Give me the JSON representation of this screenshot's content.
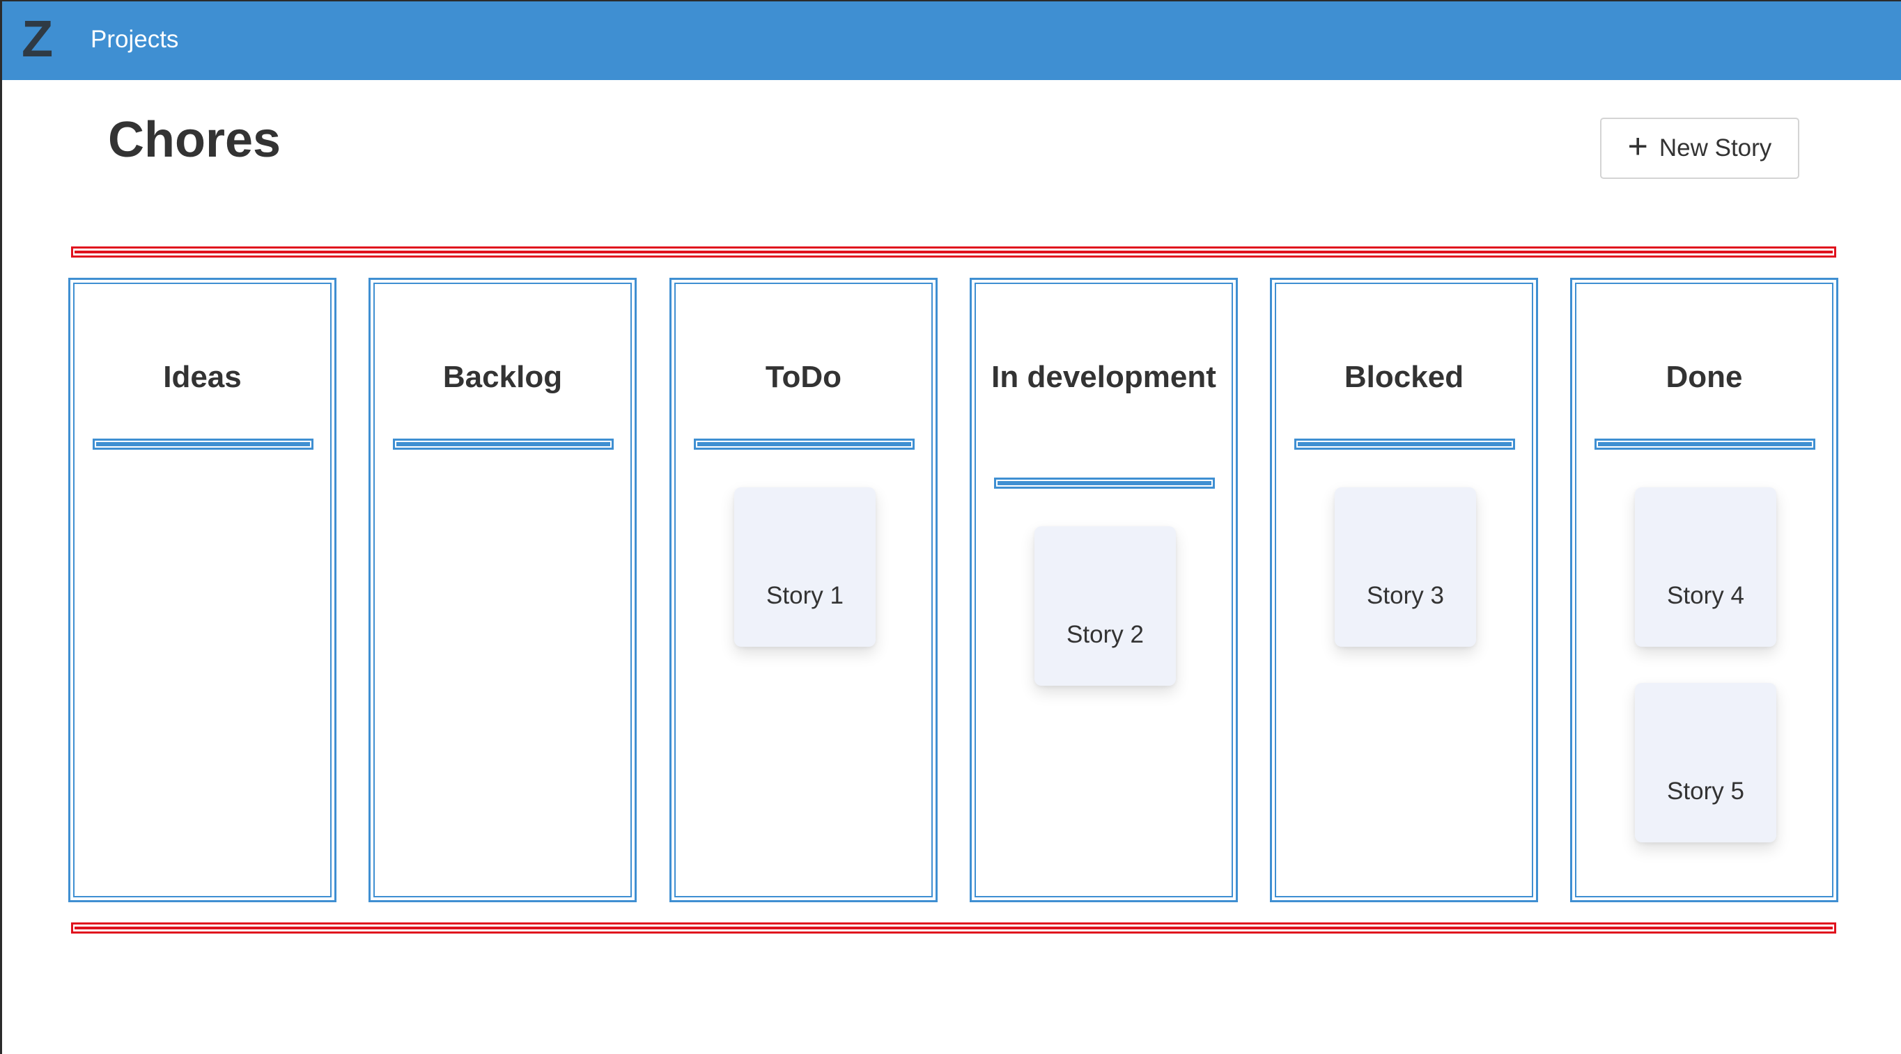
{
  "navbar": {
    "brand": "Z",
    "projects_link": "Projects",
    "background_color": "#3f8fd2"
  },
  "page": {
    "title": "Chores",
    "new_story_button": {
      "icon": "plus-icon",
      "label": "New Story"
    }
  },
  "board": {
    "drop_zone_color": "#e0121e",
    "column_border_color": "#3f8fd2",
    "columns": [
      {
        "title": "Ideas",
        "stories": []
      },
      {
        "title": "Backlog",
        "stories": []
      },
      {
        "title": "ToDo",
        "stories": [
          {
            "title": "Story 1"
          }
        ]
      },
      {
        "title": "In development",
        "stories": [
          {
            "title": "Story 2"
          }
        ]
      },
      {
        "title": "Blocked",
        "stories": [
          {
            "title": "Story 3"
          }
        ]
      },
      {
        "title": "Done",
        "stories": [
          {
            "title": "Story 4"
          },
          {
            "title": "Story 5"
          }
        ]
      }
    ]
  }
}
